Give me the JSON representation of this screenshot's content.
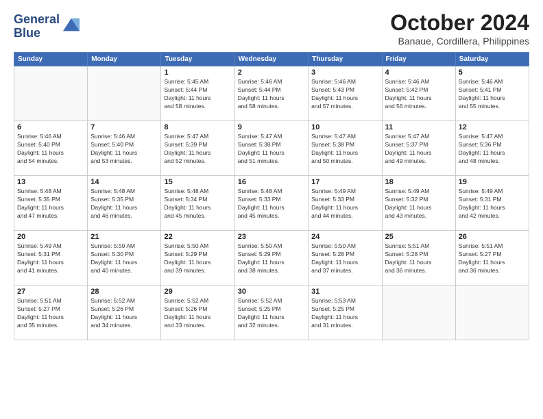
{
  "logo": {
    "line1": "General",
    "line2": "Blue"
  },
  "title": "October 2024",
  "location": "Banaue, Cordillera, Philippines",
  "headers": [
    "Sunday",
    "Monday",
    "Tuesday",
    "Wednesday",
    "Thursday",
    "Friday",
    "Saturday"
  ],
  "weeks": [
    [
      {
        "day": "",
        "info": ""
      },
      {
        "day": "",
        "info": ""
      },
      {
        "day": "1",
        "info": "Sunrise: 5:45 AM\nSunset: 5:44 PM\nDaylight: 11 hours\nand 58 minutes."
      },
      {
        "day": "2",
        "info": "Sunrise: 5:46 AM\nSunset: 5:44 PM\nDaylight: 11 hours\nand 58 minutes."
      },
      {
        "day": "3",
        "info": "Sunrise: 5:46 AM\nSunset: 5:43 PM\nDaylight: 11 hours\nand 57 minutes."
      },
      {
        "day": "4",
        "info": "Sunrise: 5:46 AM\nSunset: 5:42 PM\nDaylight: 11 hours\nand 56 minutes."
      },
      {
        "day": "5",
        "info": "Sunrise: 5:46 AM\nSunset: 5:41 PM\nDaylight: 11 hours\nand 55 minutes."
      }
    ],
    [
      {
        "day": "6",
        "info": "Sunrise: 5:46 AM\nSunset: 5:40 PM\nDaylight: 11 hours\nand 54 minutes."
      },
      {
        "day": "7",
        "info": "Sunrise: 5:46 AM\nSunset: 5:40 PM\nDaylight: 11 hours\nand 53 minutes."
      },
      {
        "day": "8",
        "info": "Sunrise: 5:47 AM\nSunset: 5:39 PM\nDaylight: 11 hours\nand 52 minutes."
      },
      {
        "day": "9",
        "info": "Sunrise: 5:47 AM\nSunset: 5:38 PM\nDaylight: 11 hours\nand 51 minutes."
      },
      {
        "day": "10",
        "info": "Sunrise: 5:47 AM\nSunset: 5:38 PM\nDaylight: 11 hours\nand 50 minutes."
      },
      {
        "day": "11",
        "info": "Sunrise: 5:47 AM\nSunset: 5:37 PM\nDaylight: 11 hours\nand 49 minutes."
      },
      {
        "day": "12",
        "info": "Sunrise: 5:47 AM\nSunset: 5:36 PM\nDaylight: 11 hours\nand 48 minutes."
      }
    ],
    [
      {
        "day": "13",
        "info": "Sunrise: 5:48 AM\nSunset: 5:35 PM\nDaylight: 11 hours\nand 47 minutes."
      },
      {
        "day": "14",
        "info": "Sunrise: 5:48 AM\nSunset: 5:35 PM\nDaylight: 11 hours\nand 46 minutes."
      },
      {
        "day": "15",
        "info": "Sunrise: 5:48 AM\nSunset: 5:34 PM\nDaylight: 11 hours\nand 45 minutes."
      },
      {
        "day": "16",
        "info": "Sunrise: 5:48 AM\nSunset: 5:33 PM\nDaylight: 11 hours\nand 45 minutes."
      },
      {
        "day": "17",
        "info": "Sunrise: 5:49 AM\nSunset: 5:33 PM\nDaylight: 11 hours\nand 44 minutes."
      },
      {
        "day": "18",
        "info": "Sunrise: 5:49 AM\nSunset: 5:32 PM\nDaylight: 11 hours\nand 43 minutes."
      },
      {
        "day": "19",
        "info": "Sunrise: 5:49 AM\nSunset: 5:31 PM\nDaylight: 11 hours\nand 42 minutes."
      }
    ],
    [
      {
        "day": "20",
        "info": "Sunrise: 5:49 AM\nSunset: 5:31 PM\nDaylight: 11 hours\nand 41 minutes."
      },
      {
        "day": "21",
        "info": "Sunrise: 5:50 AM\nSunset: 5:30 PM\nDaylight: 11 hours\nand 40 minutes."
      },
      {
        "day": "22",
        "info": "Sunrise: 5:50 AM\nSunset: 5:29 PM\nDaylight: 11 hours\nand 39 minutes."
      },
      {
        "day": "23",
        "info": "Sunrise: 5:50 AM\nSunset: 5:29 PM\nDaylight: 11 hours\nand 38 minutes."
      },
      {
        "day": "24",
        "info": "Sunrise: 5:50 AM\nSunset: 5:28 PM\nDaylight: 11 hours\nand 37 minutes."
      },
      {
        "day": "25",
        "info": "Sunrise: 5:51 AM\nSunset: 5:28 PM\nDaylight: 11 hours\nand 36 minutes."
      },
      {
        "day": "26",
        "info": "Sunrise: 5:51 AM\nSunset: 5:27 PM\nDaylight: 11 hours\nand 36 minutes."
      }
    ],
    [
      {
        "day": "27",
        "info": "Sunrise: 5:51 AM\nSunset: 5:27 PM\nDaylight: 11 hours\nand 35 minutes."
      },
      {
        "day": "28",
        "info": "Sunrise: 5:52 AM\nSunset: 5:26 PM\nDaylight: 11 hours\nand 34 minutes."
      },
      {
        "day": "29",
        "info": "Sunrise: 5:52 AM\nSunset: 5:26 PM\nDaylight: 11 hours\nand 33 minutes."
      },
      {
        "day": "30",
        "info": "Sunrise: 5:52 AM\nSunset: 5:25 PM\nDaylight: 11 hours\nand 32 minutes."
      },
      {
        "day": "31",
        "info": "Sunrise: 5:53 AM\nSunset: 5:25 PM\nDaylight: 11 hours\nand 31 minutes."
      },
      {
        "day": "",
        "info": ""
      },
      {
        "day": "",
        "info": ""
      }
    ]
  ]
}
